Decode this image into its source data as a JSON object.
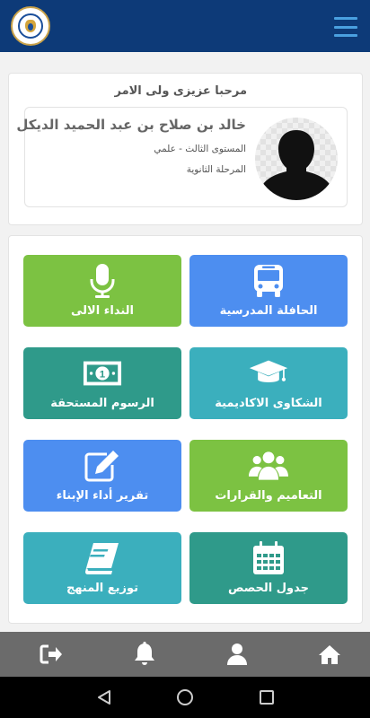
{
  "header": {
    "logo_icon": "school-logo",
    "menu_icon": "hamburger-menu-icon"
  },
  "welcome": {
    "title": "مرحبا عزيزى ولى الامر",
    "student_name": "خالد بن صلاح بن عبد الحميد الديكل",
    "level": "المستوى الثالث - علمي",
    "stage": "المرحلة الثانوية",
    "avatar_icon": "user-silhouette"
  },
  "tiles": [
    {
      "label": "الحافلة المدرسية",
      "icon": "bus-icon",
      "color": "#4d8ef0"
    },
    {
      "label": "النداء الالى",
      "icon": "microphone-icon",
      "color": "#7cc242"
    },
    {
      "label": "الشكاوى الاكاديمية",
      "icon": "graduation-cap-icon",
      "color": "#3bafbd"
    },
    {
      "label": "الرسوم المستحقة",
      "icon": "money-bill-icon",
      "color": "#2f9a8a"
    },
    {
      "label": "التعاميم والقرارات",
      "icon": "users-icon",
      "color": "#7cc242"
    },
    {
      "label": "تقرير أداء الإبناء",
      "icon": "edit-icon",
      "color": "#4d8ef0"
    },
    {
      "label": "جدول الحصص",
      "icon": "calendar-icon",
      "color": "#2f9a8a"
    },
    {
      "label": "توزيع المنهج",
      "icon": "book-icon",
      "color": "#3bafbd"
    }
  ],
  "bottom_nav": [
    "home-icon",
    "user-icon",
    "bell-icon",
    "sign-out-icon"
  ],
  "system_nav": [
    "back-icon",
    "home-circle-icon",
    "recents-icon"
  ]
}
